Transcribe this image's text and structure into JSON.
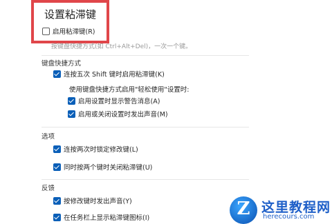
{
  "header": {
    "title": "设置粘滞键"
  },
  "enable": {
    "label": "启用粘滞键(R)",
    "checked": false
  },
  "desc_partial": "按键盘快捷方式(如 Ctrl+Alt+Del)，一次一个键。",
  "shortcut_section": {
    "title": "键盘快捷方式",
    "shift_toggle": {
      "label": "连按五次 Shift 键时启用粘滞键(K)",
      "checked": true
    },
    "sub_heading": "使用键盘快捷方式启用\"轻松使用\"设置时:",
    "warn_toggle": {
      "label": "启用设置时显示警告消息(A)",
      "checked": true
    },
    "sound_toggle": {
      "label": "启用或关闭设置时发出声音(M)",
      "checked": true
    }
  },
  "options_section": {
    "title": "选项",
    "lock_toggle": {
      "label": "连按两次时锁定修改键(L)",
      "checked": true
    },
    "two_keys_toggle": {
      "label": "同时按两个键时关闭粘滞键(U)",
      "checked": true
    }
  },
  "feedback_section": {
    "title": "反馈",
    "beep_toggle": {
      "label": "按修改键时发出声音(Y)",
      "checked": true
    },
    "taskbar_toggle": {
      "label": "在任务栏上显示粘滞键图标(I)",
      "checked": true
    }
  },
  "watermark": {
    "main": "这里教程网",
    "sub": "herecours.com",
    "letter": "Z"
  },
  "colors": {
    "highlight": "#e0464a",
    "accent": "#0a5fb8"
  }
}
